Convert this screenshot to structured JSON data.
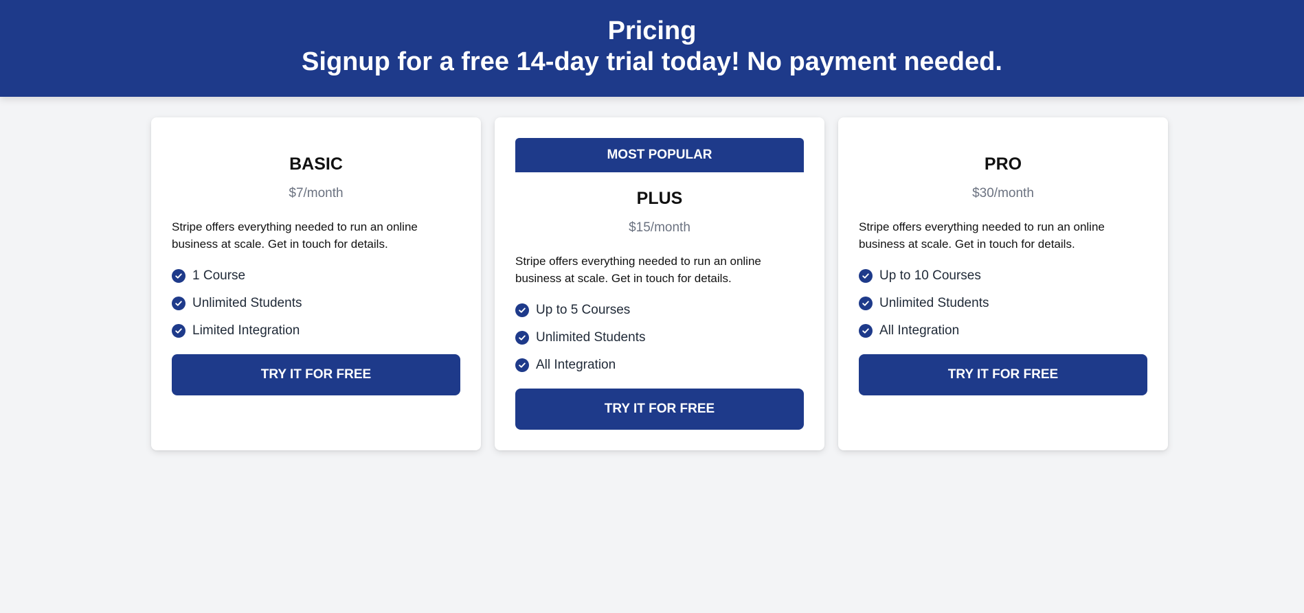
{
  "header": {
    "title": "Pricing",
    "subtitle": "Signup for a free 14-day trial today! No payment needed."
  },
  "colors": {
    "brand": "#1e3a8a",
    "background": "#f3f4f6",
    "card": "#ffffff",
    "muted_text": "#6b7280"
  },
  "plans": [
    {
      "name": "BASIC",
      "price": "$7/month",
      "description": "Stripe offers everything needed to run an online business at scale. Get in touch for details.",
      "features": [
        "1 Course",
        "Unlimited Students",
        "Limited Integration"
      ],
      "cta_label": "TRY IT FOR FREE",
      "feature_icon": "check-circle-icon"
    },
    {
      "badge": "MOST POPULAR",
      "name": "PLUS",
      "price": "$15/month",
      "description": "Stripe offers everything needed to run an online business at scale. Get in touch for details.",
      "features": [
        "Up to 5 Courses",
        "Unlimited Students",
        "All Integration"
      ],
      "cta_label": "TRY IT FOR FREE",
      "feature_icon": "check-circle-icon"
    },
    {
      "name": "PRO",
      "price": "$30/month",
      "description": "Stripe offers everything needed to run an online business at scale. Get in touch for details.",
      "features": [
        "Up to 10 Courses",
        "Unlimited Students",
        "All Integration"
      ],
      "cta_label": "TRY IT FOR FREE",
      "feature_icon": "check-circle-icon"
    }
  ]
}
